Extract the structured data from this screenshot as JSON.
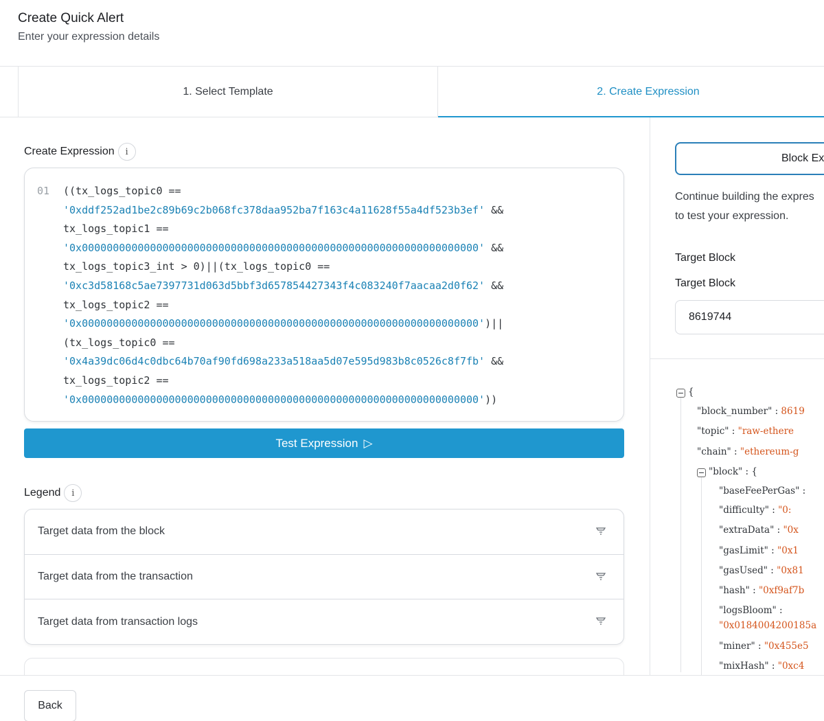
{
  "header": {
    "title": "Create Quick Alert",
    "subtitle": "Enter your expression details"
  },
  "tabs": [
    {
      "label": "1. Select Template",
      "active": false
    },
    {
      "label": "2. Create Expression",
      "active": true
    }
  ],
  "expression": {
    "label": "Create Expression",
    "info_icon": "i",
    "line_number": "01",
    "lines": [
      {
        "text": "((tx_logs_topic0 ==",
        "kind": "kw"
      },
      {
        "text": "'0xddf252ad1be2c89b69c2b068fc378daa952ba7f163c4a11628f55a4df523b3ef'",
        "tail": " &&",
        "kind": "str"
      },
      {
        "text": "tx_logs_topic1 ==",
        "kind": "kw"
      },
      {
        "text": "'0x0000000000000000000000000000000000000000000000000000000000000000'",
        "tail": " &&",
        "kind": "str"
      },
      {
        "text": "tx_logs_topic3_int > 0)||(tx_logs_topic0 ==",
        "kind": "kw"
      },
      {
        "text": "'0xc3d58168c5ae7397731d063d5bbf3d657854427343f4c083240f7aacaa2d0f62'",
        "tail": " &&",
        "kind": "str"
      },
      {
        "text": "tx_logs_topic2 ==",
        "kind": "kw"
      },
      {
        "text": "'0x0000000000000000000000000000000000000000000000000000000000000000'",
        "tail": ")||",
        "kind": "str"
      },
      {
        "text": "(tx_logs_topic0 ==",
        "kind": "kw"
      },
      {
        "text": "'0x4a39dc06d4c0dbc64b70af90fd698a233a518aa5d07e595d983b8c0526c8f7fb'",
        "tail": " &&",
        "kind": "str"
      },
      {
        "text": "tx_logs_topic2 ==",
        "kind": "kw"
      },
      {
        "text": "'0x0000000000000000000000000000000000000000000000000000000000000000'",
        "tail": "))",
        "kind": "str"
      }
    ],
    "test_button_label": "Test Expression",
    "test_button_icon": "▷"
  },
  "legend": {
    "label": "Legend",
    "info_icon": "i",
    "items": [
      {
        "label": "Target data from the block"
      },
      {
        "label": "Target data from the transaction"
      },
      {
        "label": "Target data from transaction logs"
      }
    ]
  },
  "footer": {
    "back_label": "Back"
  },
  "right_panel": {
    "block_button_label": "Block Ex",
    "help_line1": "Continue building the expres",
    "help_line2": "to test your expression.",
    "target_block_heading": "Target Block",
    "target_block_label": "Target Block",
    "target_block_value": "8619744"
  },
  "json_view": {
    "rows": [
      {
        "indent": 0,
        "toggle": true,
        "key": "",
        "value": "",
        "text": "{"
      },
      {
        "indent": 1,
        "key": "\"block_number\"",
        "value": "8619"
      },
      {
        "indent": 1,
        "key": "\"topic\"",
        "value": "\"raw-ethere"
      },
      {
        "indent": 1,
        "key": "\"chain\"",
        "value": "\"ethereum-g"
      },
      {
        "indent": 1,
        "toggle": true,
        "key": "\"block\"",
        "value": "",
        "text": "{"
      },
      {
        "indent": 2,
        "key": "\"baseFeePerGas\"",
        "value": ""
      },
      {
        "indent": 2,
        "key": "\"difficulty\"",
        "value": "\"0:"
      },
      {
        "indent": 2,
        "key": "\"extraData\"",
        "value": "\"0x"
      },
      {
        "indent": 2,
        "key": "\"gasLimit\"",
        "value": "\"0x1"
      },
      {
        "indent": 2,
        "key": "\"gasUsed\"",
        "value": "\"0x81"
      },
      {
        "indent": 2,
        "key": "\"hash\"",
        "value": "\"0xf9af7b"
      },
      {
        "indent": 2,
        "key": "\"logsBloom\"",
        "value": "",
        "wrap": "\"0x0184004200185a"
      },
      {
        "indent": 2,
        "key": "\"miner\"",
        "value": "\"0x455e5"
      },
      {
        "indent": 2,
        "key": "\"mixHash\"",
        "value": "\"0xc4"
      }
    ]
  }
}
